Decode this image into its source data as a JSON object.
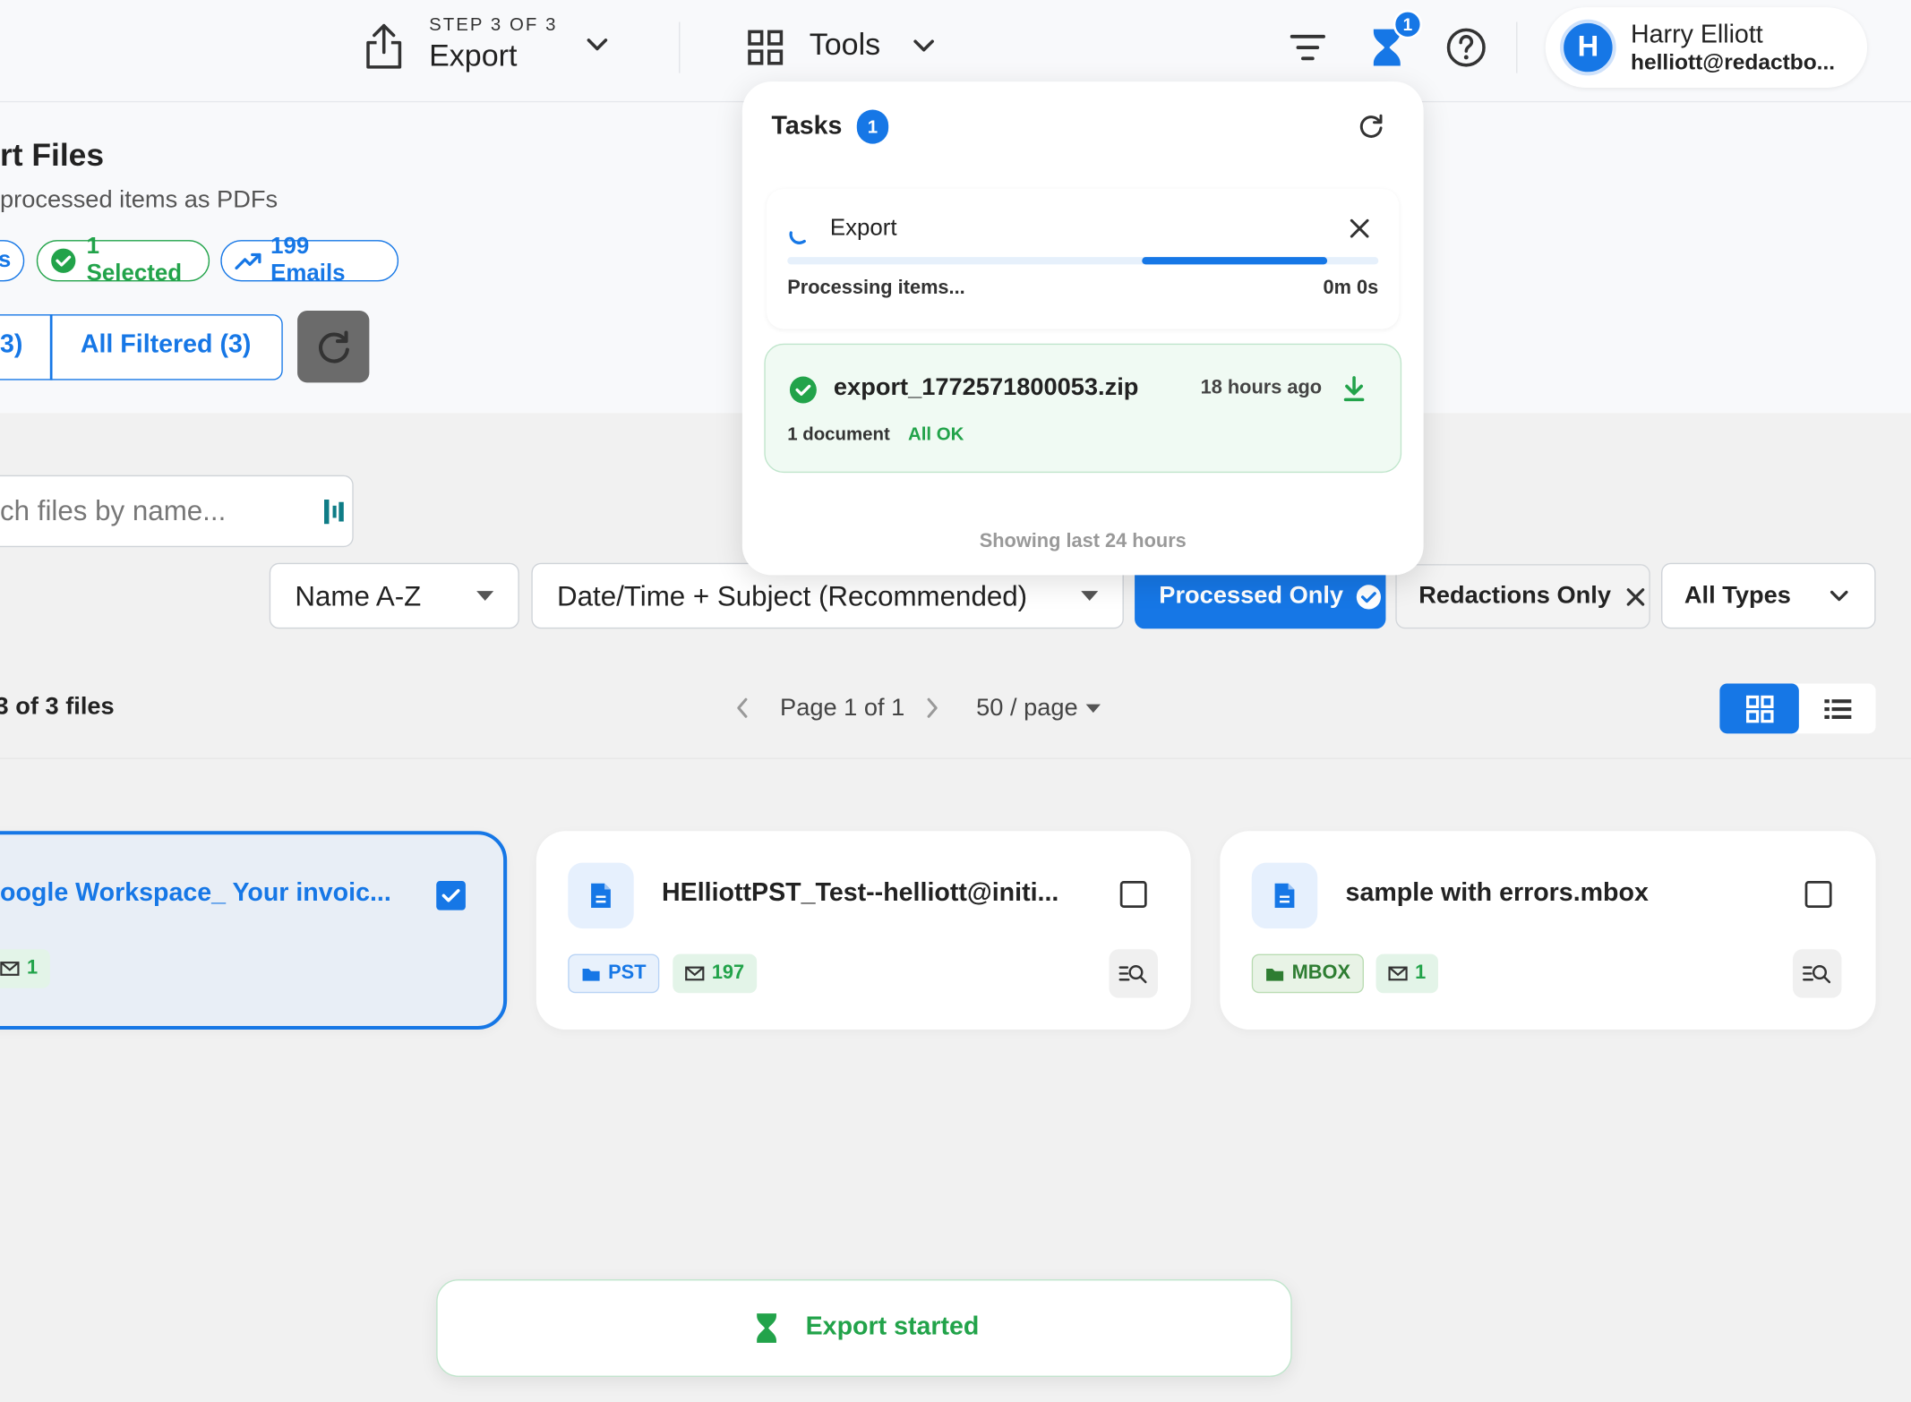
{
  "header": {
    "step_label": "STEP 3 OF 3",
    "step_title": "Export",
    "tools_label": "Tools",
    "hourglass_badge": "1",
    "user_initial": "H",
    "user_name": "Harry Elliott",
    "user_email": "helliott@redactbo..."
  },
  "page": {
    "title": "rt Files",
    "subtitle": "processed items as PDFs",
    "pill_partial": "s",
    "pill_selected": "1 Selected",
    "pill_emails": "199 Emails",
    "btn_partial": "3)",
    "btn_all_filtered": "All Filtered (3)"
  },
  "search": {
    "placeholder_visible": "ch files by name..."
  },
  "filters": {
    "sort_name": "Name A-Z",
    "sort_date": "Date/Time + Subject (Recommended)",
    "processed_only": "Processed Only",
    "redactions_only": "Redactions Only",
    "all_types": "All Types"
  },
  "listing": {
    "count_text": "of 3 files",
    "count_prefix": "3",
    "page_text": "Page 1 of 1",
    "per_page": "50 / page"
  },
  "cards": [
    {
      "name": "oogle Workspace_ Your invoic...",
      "count": "1",
      "checked": true
    },
    {
      "name": "HElliottPST_Test--helliott@initi...",
      "type": "PST",
      "count": "197",
      "checked": false
    },
    {
      "name": "sample with errors.mbox",
      "type": "MBOX",
      "count": "1",
      "checked": false
    }
  ],
  "tasks": {
    "title": "Tasks",
    "badge": "1",
    "export_title": "Export",
    "export_progress": 0.6,
    "processing_label": "Processing items...",
    "elapsed": "0m 0s",
    "file_name": "export_1772571800053.zip",
    "file_time": "18 hours ago",
    "file_docs": "1 document",
    "file_status": "All OK",
    "footer": "Showing last 24 hours"
  },
  "toast": {
    "text": "Export started"
  },
  "colors": {
    "primary": "#1677e6",
    "success": "#22a34a",
    "dark_button": "#6b6b6b"
  }
}
